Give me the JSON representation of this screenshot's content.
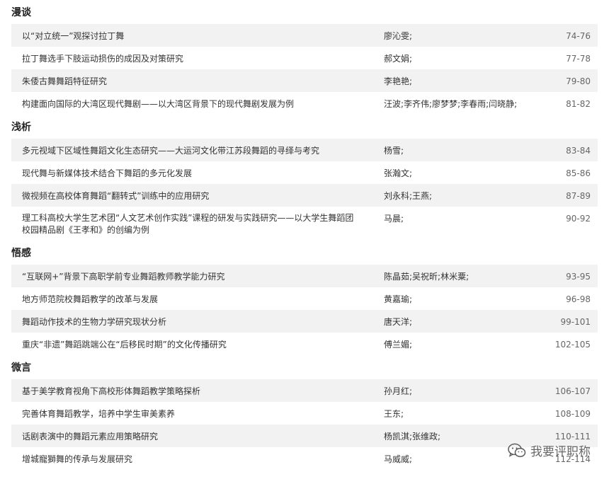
{
  "sections": [
    {
      "title": "漫谈",
      "rows": [
        {
          "title": "以“对立统一”观探讨拉丁舞",
          "author": "廖沁雯;",
          "pages": "74-76"
        },
        {
          "title": "拉丁舞选手下肢运动损伤的成因及对策研究",
          "author": "郝文娟;",
          "pages": "77-78"
        },
        {
          "title": "朱倭古舞舞蹈特征研究",
          "author": "李艳艳;",
          "pages": "79-80"
        },
        {
          "title": "构建面向国际的大湾区现代舞剧——以大湾区背景下的现代舞剧发展为例",
          "author": "汪波;李齐伟;廖梦梦;李春雨;闫晓静;",
          "pages": "81-82"
        }
      ]
    },
    {
      "title": "浅析",
      "rows": [
        {
          "title": "多元视域下区域性舞蹈文化生态研究——大运河文化带江苏段舞蹈的寻绎与考究",
          "author": "杨雪;",
          "pages": "83-84"
        },
        {
          "title": "现代舞与新媒体技术结合下舞蹈的多元化发展",
          "author": "张瀚文;",
          "pages": "85-86"
        },
        {
          "title": "微视频在高校体育舞蹈“翻转式”训练中的应用研究",
          "author": "刘永科;王燕;",
          "pages": "87-89"
        },
        {
          "title": "理工科高校大学生艺术团“人文艺术创作实践”课程的研发与实践研究——以大学生舞蹈团校园精品剧《王孝和》的创编为例",
          "author": "马晨;",
          "pages": "90-92"
        }
      ]
    },
    {
      "title": "悟感",
      "rows": [
        {
          "title": "“互联网+”背景下高职学前专业舞蹈教师教学能力研究",
          "author": "陈晶茹;吴祝昕;林米粟;",
          "pages": "93-95"
        },
        {
          "title": "地方师范院校舞蹈教学的改革与发展",
          "author": "黄嘉瑜;",
          "pages": "96-98"
        },
        {
          "title": "舞蹈动作技术的生物力学研究现状分析",
          "author": "唐天洋;",
          "pages": "99-101"
        },
        {
          "title": "重庆“非遗”舞蹈跳端公在“后移民时期”的文化传播研究",
          "author": "傅兰媚;",
          "pages": "102-105"
        }
      ]
    },
    {
      "title": "微言",
      "rows": [
        {
          "title": "基于美学教育视角下高校形体舞蹈教学策略探析",
          "author": "孙月红;",
          "pages": "106-107"
        },
        {
          "title": "完善体育舞蹈教学，培养中学生审美素养",
          "author": "王东;",
          "pages": "108-109"
        },
        {
          "title": "话剧表演中的舞蹈元素应用策略研究",
          "author": "杨凯淇;张维政;",
          "pages": "110-111"
        },
        {
          "title": "增城寵獅舞的传承与发展研究",
          "author": "马威威;",
          "pages": "112-114"
        }
      ]
    }
  ],
  "watermark": {
    "text": "我要评职称",
    "icon": "wechat-icon"
  }
}
